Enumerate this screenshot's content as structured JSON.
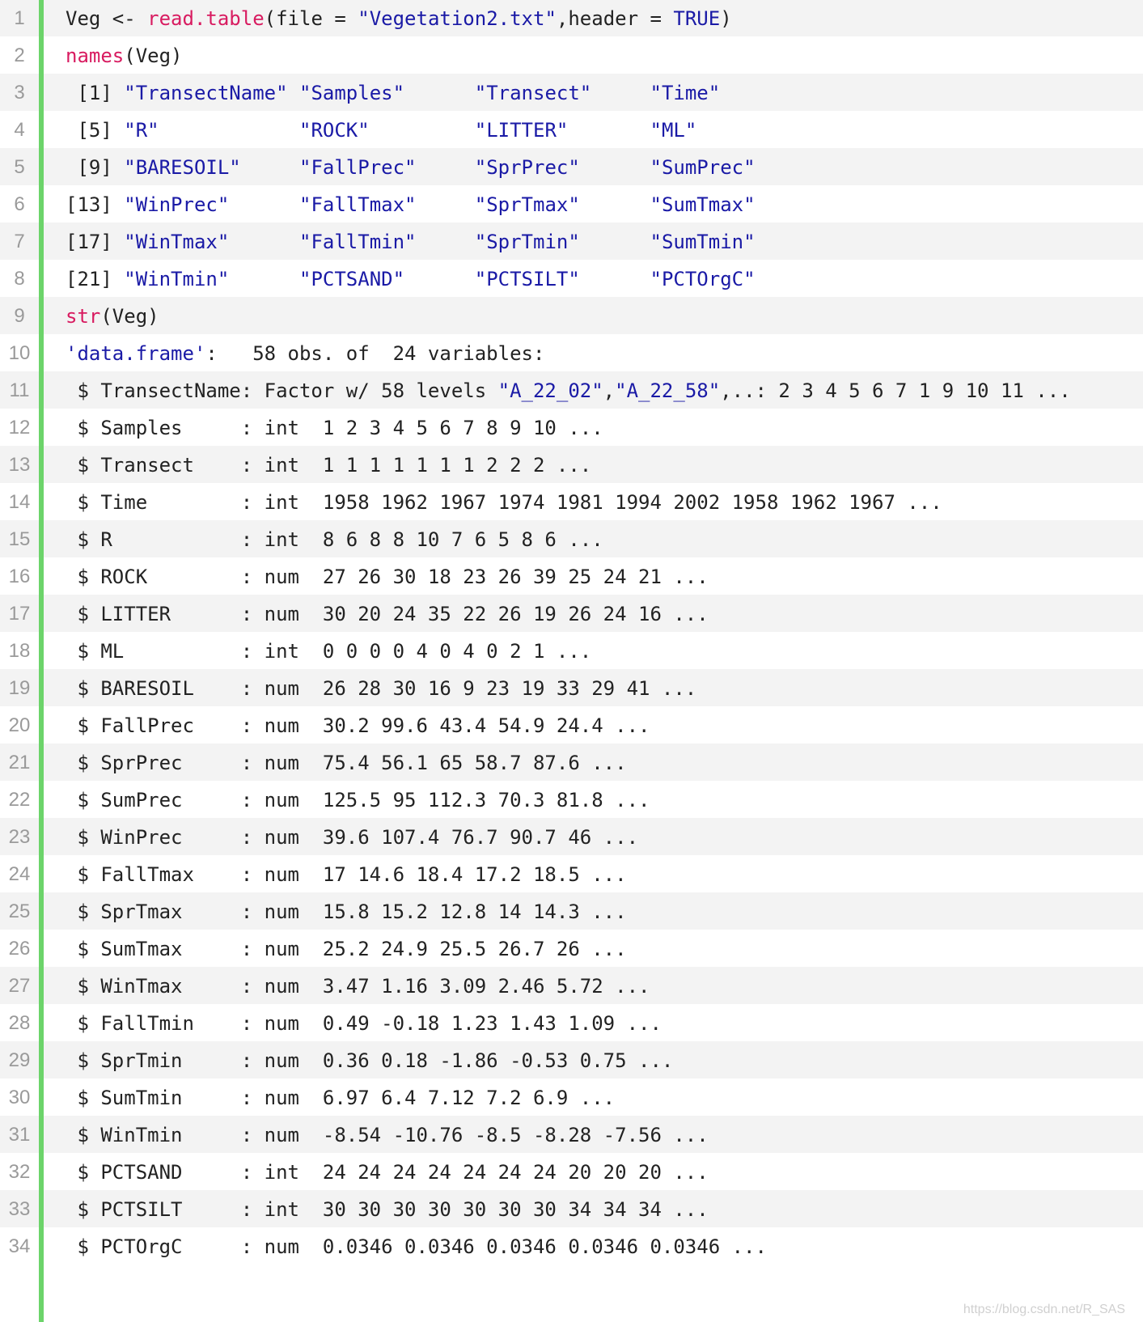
{
  "editor": {
    "lines": [
      {
        "num": "1",
        "tokens": [
          {
            "t": "Veg <- ",
            "c": "plain"
          },
          {
            "t": "read.table",
            "c": "fn"
          },
          {
            "t": "(file = ",
            "c": "plain"
          },
          {
            "t": "\"Vegetation2.txt\"",
            "c": "str"
          },
          {
            "t": ",header = ",
            "c": "plain"
          },
          {
            "t": "TRUE",
            "c": "kw"
          },
          {
            "t": ")",
            "c": "plain"
          }
        ]
      },
      {
        "num": "2",
        "tokens": [
          {
            "t": "names",
            "c": "fn"
          },
          {
            "t": "(Veg)",
            "c": "plain"
          }
        ]
      },
      {
        "num": "3",
        "tokens": [
          {
            "t": " [1] ",
            "c": "plain"
          },
          {
            "t": "\"TransectName\"",
            "c": "str"
          },
          {
            "t": " ",
            "c": "plain"
          },
          {
            "t": "\"Samples\"",
            "c": "str"
          },
          {
            "t": "      ",
            "c": "plain"
          },
          {
            "t": "\"Transect\"",
            "c": "str"
          },
          {
            "t": "     ",
            "c": "plain"
          },
          {
            "t": "\"Time\"",
            "c": "str"
          }
        ]
      },
      {
        "num": "4",
        "tokens": [
          {
            "t": " [5] ",
            "c": "plain"
          },
          {
            "t": "\"R\"",
            "c": "str"
          },
          {
            "t": "            ",
            "c": "plain"
          },
          {
            "t": "\"ROCK\"",
            "c": "str"
          },
          {
            "t": "         ",
            "c": "plain"
          },
          {
            "t": "\"LITTER\"",
            "c": "str"
          },
          {
            "t": "       ",
            "c": "plain"
          },
          {
            "t": "\"ML\"",
            "c": "str"
          }
        ]
      },
      {
        "num": "5",
        "tokens": [
          {
            "t": " [9] ",
            "c": "plain"
          },
          {
            "t": "\"BARESOIL\"",
            "c": "str"
          },
          {
            "t": "     ",
            "c": "plain"
          },
          {
            "t": "\"FallPrec\"",
            "c": "str"
          },
          {
            "t": "     ",
            "c": "plain"
          },
          {
            "t": "\"SprPrec\"",
            "c": "str"
          },
          {
            "t": "      ",
            "c": "plain"
          },
          {
            "t": "\"SumPrec\"",
            "c": "str"
          }
        ]
      },
      {
        "num": "6",
        "tokens": [
          {
            "t": "[13] ",
            "c": "plain"
          },
          {
            "t": "\"WinPrec\"",
            "c": "str"
          },
          {
            "t": "      ",
            "c": "plain"
          },
          {
            "t": "\"FallTmax\"",
            "c": "str"
          },
          {
            "t": "     ",
            "c": "plain"
          },
          {
            "t": "\"SprTmax\"",
            "c": "str"
          },
          {
            "t": "      ",
            "c": "plain"
          },
          {
            "t": "\"SumTmax\"",
            "c": "str"
          }
        ]
      },
      {
        "num": "7",
        "tokens": [
          {
            "t": "[17] ",
            "c": "plain"
          },
          {
            "t": "\"WinTmax\"",
            "c": "str"
          },
          {
            "t": "      ",
            "c": "plain"
          },
          {
            "t": "\"FallTmin\"",
            "c": "str"
          },
          {
            "t": "     ",
            "c": "plain"
          },
          {
            "t": "\"SprTmin\"",
            "c": "str"
          },
          {
            "t": "      ",
            "c": "plain"
          },
          {
            "t": "\"SumTmin\"",
            "c": "str"
          }
        ]
      },
      {
        "num": "8",
        "tokens": [
          {
            "t": "[21] ",
            "c": "plain"
          },
          {
            "t": "\"WinTmin\"",
            "c": "str"
          },
          {
            "t": "      ",
            "c": "plain"
          },
          {
            "t": "\"PCTSAND\"",
            "c": "str"
          },
          {
            "t": "      ",
            "c": "plain"
          },
          {
            "t": "\"PCTSILT\"",
            "c": "str"
          },
          {
            "t": "      ",
            "c": "plain"
          },
          {
            "t": "\"PCTOrgC\"",
            "c": "str"
          }
        ]
      },
      {
        "num": "9",
        "tokens": [
          {
            "t": "str",
            "c": "fn"
          },
          {
            "t": "(Veg)",
            "c": "plain"
          }
        ]
      },
      {
        "num": "10",
        "tokens": [
          {
            "t": "'data.frame'",
            "c": "str"
          },
          {
            "t": ":   58 obs. of  24 variables:",
            "c": "plain"
          }
        ]
      },
      {
        "num": "11",
        "tokens": [
          {
            "t": " $ TransectName: Factor w/ 58 levels ",
            "c": "plain"
          },
          {
            "t": "\"A_22_02\"",
            "c": "str"
          },
          {
            "t": ",",
            "c": "plain"
          },
          {
            "t": "\"A_22_58\"",
            "c": "str"
          },
          {
            "t": ",..: 2 3 4 5 6 7 1 9 10 11 ...",
            "c": "plain"
          }
        ]
      },
      {
        "num": "12",
        "tokens": [
          {
            "t": " $ Samples     : int  1 2 3 4 5 6 7 8 9 10 ...",
            "c": "plain"
          }
        ]
      },
      {
        "num": "13",
        "tokens": [
          {
            "t": " $ Transect    : int  1 1 1 1 1 1 1 2 2 2 ...",
            "c": "plain"
          }
        ]
      },
      {
        "num": "14",
        "tokens": [
          {
            "t": " $ Time        : int  1958 1962 1967 1974 1981 1994 2002 1958 1962 1967 ...",
            "c": "plain"
          }
        ]
      },
      {
        "num": "15",
        "tokens": [
          {
            "t": " $ R           : int  8 6 8 8 10 7 6 5 8 6 ...",
            "c": "plain"
          }
        ]
      },
      {
        "num": "16",
        "tokens": [
          {
            "t": " $ ROCK        : num  27 26 30 18 23 26 39 25 24 21 ...",
            "c": "plain"
          }
        ]
      },
      {
        "num": "17",
        "tokens": [
          {
            "t": " $ LITTER      : num  30 20 24 35 22 26 19 26 24 16 ...",
            "c": "plain"
          }
        ]
      },
      {
        "num": "18",
        "tokens": [
          {
            "t": " $ ML          : int  0 0 0 0 4 0 4 0 2 1 ...",
            "c": "plain"
          }
        ]
      },
      {
        "num": "19",
        "tokens": [
          {
            "t": " $ BARESOIL    : num  26 28 30 16 9 23 19 33 29 41 ...",
            "c": "plain"
          }
        ]
      },
      {
        "num": "20",
        "tokens": [
          {
            "t": " $ FallPrec    : num  30.2 99.6 43.4 54.9 24.4 ...",
            "c": "plain"
          }
        ]
      },
      {
        "num": "21",
        "tokens": [
          {
            "t": " $ SprPrec     : num  75.4 56.1 65 58.7 87.6 ...",
            "c": "plain"
          }
        ]
      },
      {
        "num": "22",
        "tokens": [
          {
            "t": " $ SumPrec     : num  125.5 95 112.3 70.3 81.8 ...",
            "c": "plain"
          }
        ]
      },
      {
        "num": "23",
        "tokens": [
          {
            "t": " $ WinPrec     : num  39.6 107.4 76.7 90.7 46 ...",
            "c": "plain"
          }
        ]
      },
      {
        "num": "24",
        "tokens": [
          {
            "t": " $ FallTmax    : num  17 14.6 18.4 17.2 18.5 ...",
            "c": "plain"
          }
        ]
      },
      {
        "num": "25",
        "tokens": [
          {
            "t": " $ SprTmax     : num  15.8 15.2 12.8 14 14.3 ...",
            "c": "plain"
          }
        ]
      },
      {
        "num": "26",
        "tokens": [
          {
            "t": " $ SumTmax     : num  25.2 24.9 25.5 26.7 26 ...",
            "c": "plain"
          }
        ]
      },
      {
        "num": "27",
        "tokens": [
          {
            "t": " $ WinTmax     : num  3.47 1.16 3.09 2.46 5.72 ...",
            "c": "plain"
          }
        ]
      },
      {
        "num": "28",
        "tokens": [
          {
            "t": " $ FallTmin    : num  0.49 -0.18 1.23 1.43 1.09 ...",
            "c": "plain"
          }
        ]
      },
      {
        "num": "29",
        "tokens": [
          {
            "t": " $ SprTmin     : num  0.36 0.18 -1.86 -0.53 0.75 ...",
            "c": "plain"
          }
        ]
      },
      {
        "num": "30",
        "tokens": [
          {
            "t": " $ SumTmin     : num  6.97 6.4 7.12 7.2 6.9 ...",
            "c": "plain"
          }
        ]
      },
      {
        "num": "31",
        "tokens": [
          {
            "t": " $ WinTmin     : num  -8.54 -10.76 -8.5 -8.28 -7.56 ...",
            "c": "plain"
          }
        ]
      },
      {
        "num": "32",
        "tokens": [
          {
            "t": " $ PCTSAND     : int  24 24 24 24 24 24 24 20 20 20 ...",
            "c": "plain"
          }
        ]
      },
      {
        "num": "33",
        "tokens": [
          {
            "t": " $ PCTSILT     : int  30 30 30 30 30 30 30 34 34 34 ...",
            "c": "plain"
          }
        ]
      },
      {
        "num": "34",
        "tokens": [
          {
            "t": " $ PCTOrgC     : num  0.0346 0.0346 0.0346 0.0346 0.0346 ...",
            "c": "plain"
          }
        ]
      }
    ]
  },
  "watermark": "https://blog.csdn.net/R_SAS",
  "colors": {
    "function": "#d81b60",
    "string": "#1a1aa6",
    "text": "#222222",
    "line_number": "#9a9a9a",
    "gutter_bar": "#6cd46a",
    "row_alt": "#f3f3f3"
  }
}
